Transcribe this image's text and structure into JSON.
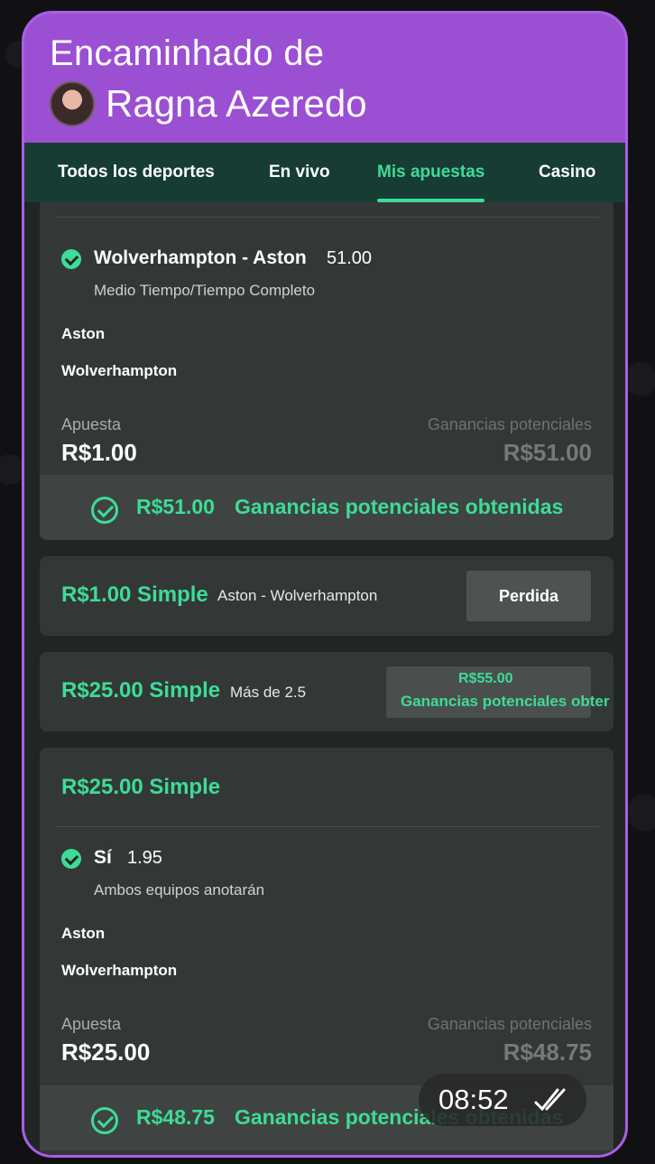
{
  "forward": {
    "prefix": "Encaminhado de",
    "sender": "Ragna Azeredo"
  },
  "nav": {
    "tabs": [
      "Todos los deportes",
      "En vivo",
      "Mis apuestas",
      "Casino"
    ],
    "active": "Mis apuestas"
  },
  "bet1": {
    "selection": "Wolverhampton - Aston",
    "odds": "51.00",
    "market": "Medio Tiempo/Tiempo Completo",
    "team1": "Aston",
    "team2": "Wolverhampton",
    "stake_label": "Apuesta",
    "stake": "R$1.00",
    "potential_label": "Ganancias potenciales",
    "potential": "R$51.00",
    "won_amount": "R$51.00",
    "won_text": "Ganancias potenciales obtenidas"
  },
  "bet2": {
    "title": "R$1.00 Simple",
    "match": "Aston - Wolverhampton",
    "status": "Perdida"
  },
  "bet3": {
    "title": "R$25.00 Simple",
    "match": "Más de 2.5",
    "cashout_amount": "R$55.00",
    "cashout_text": "Ganancias potenciales obter"
  },
  "bet4": {
    "title": "R$25.00 Simple",
    "selection": "Sí",
    "odds": "1.95",
    "market": "Ambos equipos anotarán",
    "team1": "Aston",
    "team2": "Wolverhampton",
    "stake_label": "Apuesta",
    "stake": "R$25.00",
    "potential_label": "Ganancias potenciales",
    "potential": "R$48.75",
    "won_amount": "R$48.75",
    "won_text": "Ganancias potenciales obtenidas"
  },
  "message": {
    "time": "08:52",
    "status_icon": "double-check-icon"
  },
  "colors": {
    "bubble": "#9b4fd3",
    "accent_green": "#3ddc97",
    "nav_bg": "#163c34"
  }
}
